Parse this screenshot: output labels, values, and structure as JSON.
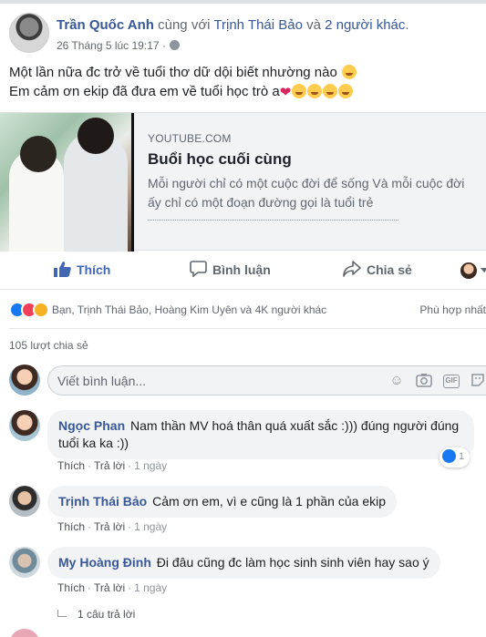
{
  "post": {
    "author": "Trần Quốc Anh",
    "with_text": " cùng với ",
    "tagged_user": "Trịnh Thái Bảo",
    "and_text": " và ",
    "others": "2 người khác",
    "period": ".",
    "timestamp": "26 Tháng 5 lúc 19:17 ·",
    "privacy_icon": "globe-icon",
    "text_line1": "Một lần nữa đc trở về tuổi thơ dữ dội biết nhường nào",
    "text_line2": "Em cảm ơn ekip đã đưa em về tuổi học trò a"
  },
  "link_card": {
    "domain": "YOUTUBE.COM",
    "title": "Buổi học cuối cùng",
    "desc_line1": "Mỗi người chỉ có một cuộc đời để sống Và mỗi cuộc đời",
    "desc_line2": "ấy chỉ có một đoạn đường gọi là tuổi trẻ"
  },
  "actions": {
    "like": "Thích",
    "comment": "Bình luận",
    "share": "Chia sẻ"
  },
  "reactions": {
    "summary": "Bạn, Trịnh Thái Bảo, Hoàng Kim Uyên và 4K người khác",
    "sort": "Phù hợp nhất"
  },
  "shares": "105 lượt chia sẻ",
  "composer": {
    "placeholder": "Viết bình luận..."
  },
  "comments": [
    {
      "name": "Ngọc Phan",
      "text_line1": "Nam thần MV hoá thân quá xuất sắc :))) đúng người đúng",
      "text_line2": "tuổi ka ka :))",
      "like": "Thích",
      "reply": "Trả lời",
      "time": "1 ngày",
      "reaction_count": "1"
    },
    {
      "name": "Trịnh Thái Bảo",
      "text": "Cảm ơn em, vì e cũng là 1 phần của ekip",
      "like": "Thích",
      "reply": "Trả lời",
      "time": "1 ngày"
    },
    {
      "name": "My Hoàng Đinh",
      "text": "Đi đâu cũng đc làm học sinh sinh viên hay sao ý",
      "like": "Thích",
      "reply": "Trả lời",
      "time": "1 ngày"
    }
  ],
  "replies_link": "1 câu trả lời",
  "colors": {
    "link_blue": "#385898",
    "like_blue": "#4267b2",
    "bubble_bg": "#f2f3f5",
    "meta_gray": "#616770"
  }
}
